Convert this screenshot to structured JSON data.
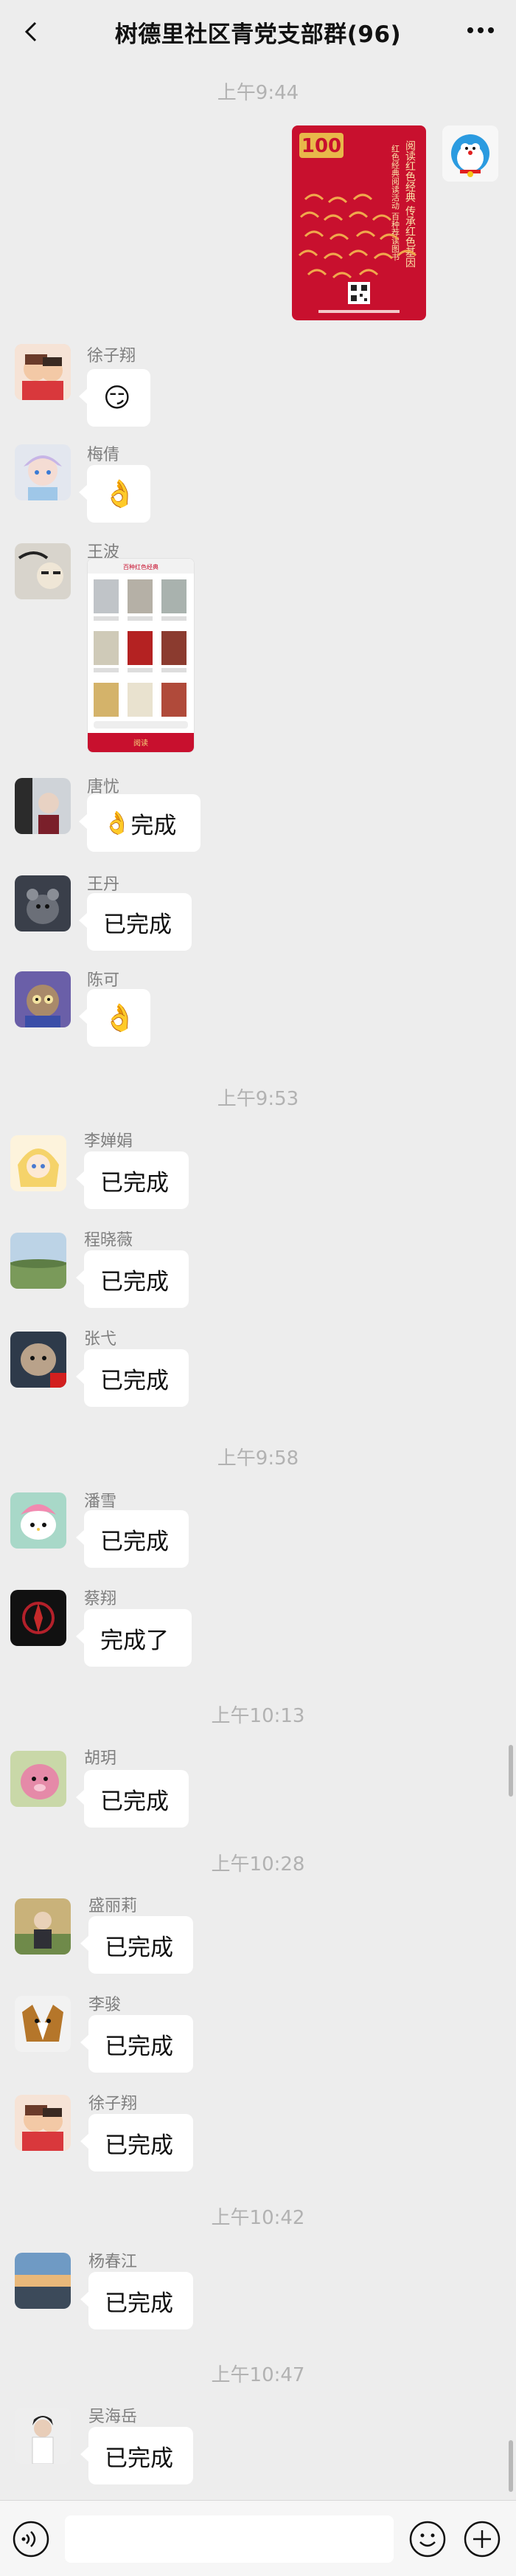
{
  "header": {
    "title": "树德里社区青党支部群(96)"
  },
  "times": [
    "上午9:44",
    "上午9:53",
    "上午9:58",
    "上午10:13",
    "上午10:28",
    "上午10:42",
    "上午10:47"
  ],
  "poster": {
    "vertical_text_1": "阅读红色经典 传承红色基因",
    "vertical_text_2": "红色经典阅读活动 百种荐读图书",
    "badge": "100"
  },
  "shared_card": {
    "header": "百种红色经典",
    "bottom_label": "阅读"
  },
  "messages": [
    {
      "sender": "徐子翔",
      "text": "",
      "emoji": "smirk-emoji"
    },
    {
      "sender": "梅倩",
      "text": "",
      "emoji": "ok-hand-emoji"
    },
    {
      "sender": "王波",
      "text": "",
      "emoji": ""
    },
    {
      "sender": "唐忧",
      "text": "完成",
      "emoji": "ok-hand-emoji"
    },
    {
      "sender": "王丹",
      "text": "已完成",
      "emoji": ""
    },
    {
      "sender": "陈可",
      "text": "",
      "emoji": "ok-hand-emoji"
    },
    {
      "sender": "李婵娟",
      "text": "已完成",
      "emoji": ""
    },
    {
      "sender": "程晓薇",
      "text": "已完成",
      "emoji": ""
    },
    {
      "sender": "张弋",
      "text": "已完成",
      "emoji": ""
    },
    {
      "sender": "潘雪",
      "text": "已完成",
      "emoji": ""
    },
    {
      "sender": "蔡翔",
      "text": "完成了",
      "emoji": ""
    },
    {
      "sender": "胡玥",
      "text": "已完成",
      "emoji": ""
    },
    {
      "sender": "盛丽莉",
      "text": "已完成",
      "emoji": ""
    },
    {
      "sender": "李骏",
      "text": "已完成",
      "emoji": ""
    },
    {
      "sender": "徐子翔",
      "text": "已完成",
      "emoji": ""
    },
    {
      "sender": "杨春江",
      "text": "已完成",
      "emoji": ""
    },
    {
      "sender": "吴海岳",
      "text": "已完成",
      "emoji": ""
    }
  ],
  "input": {
    "placeholder": ""
  },
  "colors": {
    "background": "#ededed",
    "bubble": "#ffffff",
    "poster_red": "#c8102e",
    "meta_text": "#7f7f7f",
    "time_text": "#b2b2b2"
  }
}
